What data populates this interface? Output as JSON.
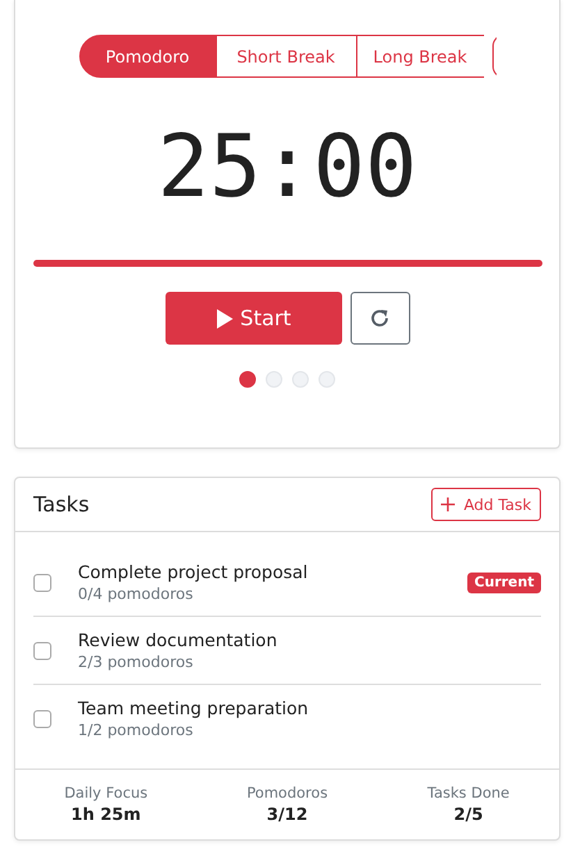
{
  "modes": [
    {
      "label": "Pomodoro",
      "selected": true
    },
    {
      "label": "Short Break",
      "selected": false
    },
    {
      "label": "Long Break",
      "selected": false
    }
  ],
  "timer": {
    "time": "25:00",
    "level": 1
  },
  "controls": {
    "start": "Start"
  },
  "sessions": [
    {
      "done": true
    },
    {
      "done": false
    },
    {
      "done": false
    },
    {
      "done": false
    }
  ],
  "tasks": {
    "title": "Tasks",
    "add_button": "Add Task",
    "items": [
      {
        "name": "Complete project proposal",
        "progress": "0/4 pomodoros",
        "checked": false,
        "badge": "Current"
      },
      {
        "name": "Review documentation",
        "progress": "2/3 pomodoros",
        "checked": false
      },
      {
        "name": "Team meeting preparation",
        "progress": "1/2 pomodoros",
        "checked": false
      }
    ]
  },
  "stats": [
    {
      "label": "Daily Focus",
      "value": "1h 25m"
    },
    {
      "label": "Pomodoros",
      "value": "3/12"
    },
    {
      "label": "Tasks Done",
      "value": "2/5"
    }
  ]
}
